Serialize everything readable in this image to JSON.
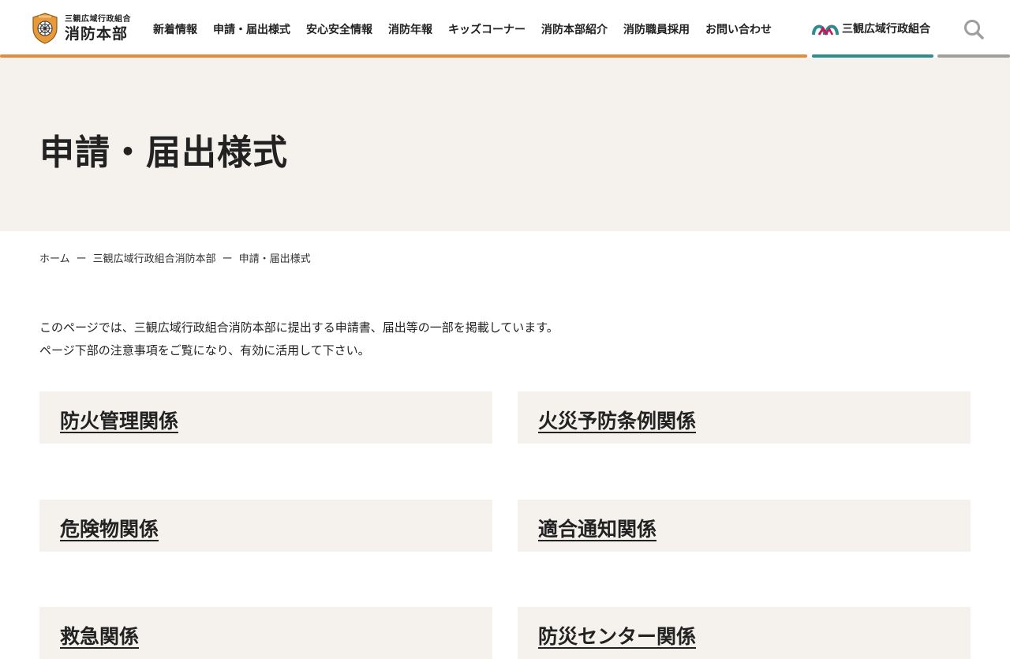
{
  "header": {
    "logo": {
      "subtitle": "三観広域行政組合",
      "title": "消防本部",
      "emblem_icon": "fire-department-emblem",
      "colors": {
        "shield": "#e89a3a",
        "inner": "#ffffff"
      }
    },
    "nav": [
      {
        "label": "新着情報"
      },
      {
        "label": "申請・届出様式"
      },
      {
        "label": "安心安全情報"
      },
      {
        "label": "消防年報"
      },
      {
        "label": "キッズコーナー"
      },
      {
        "label": "消防本部紹介"
      },
      {
        "label": "消防職員採用"
      },
      {
        "label": "お問い合わせ"
      }
    ],
    "union_link": {
      "label": "三観広域行政組合",
      "icon": "union-logo-icon"
    },
    "search_icon": "search-icon",
    "colors": {
      "accent_orange": "#e38b3e",
      "accent_teal": "#2e8b8e",
      "accent_gray": "#9e9e9e"
    }
  },
  "hero": {
    "title": "申請・届出様式",
    "background": "#f5f2ee"
  },
  "breadcrumb": [
    {
      "label": "ホーム"
    },
    {
      "label": "三観広域行政組合消防本部"
    },
    {
      "label": "申請・届出様式"
    }
  ],
  "breadcrumb_separator": "ー",
  "intro": {
    "line1": "このページでは、三観広域行政組合消防本部に提出する申請書、届出等の一部を掲載しています。",
    "line2": "ページ下部の注意事項をご覧になり、有効に活用して下さい。"
  },
  "categories": [
    {
      "label": "防火管理関係"
    },
    {
      "label": "火災予防条例関係"
    },
    {
      "label": "危険物関係"
    },
    {
      "label": "適合通知関係"
    },
    {
      "label": "救急関係"
    },
    {
      "label": "防災センター関係"
    }
  ]
}
